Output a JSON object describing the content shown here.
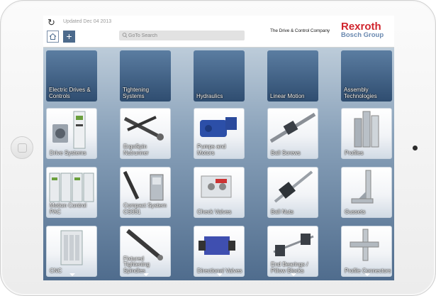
{
  "header": {
    "updated": "Updated Dec 04 2013",
    "search_placeholder": "GoTo Search",
    "tagline": "The Drive & Control Company",
    "brand_name": "Rexroth",
    "brand_sub": "Bosch Group",
    "add_label": "+"
  },
  "columns": [
    {
      "category": "Electric Drives & Controls",
      "products": [
        "Drive Systems",
        "Motion Control PAC",
        "CNC"
      ]
    },
    {
      "category": "Tightening Systems",
      "products": [
        "ErgoSpin Nutrunner",
        "Compact System CS351",
        "Fixtured Tightening Spindles"
      ]
    },
    {
      "category": "Hydraulics",
      "products": [
        "Pumps and Motors",
        "Check Valves",
        "Directional Valves"
      ]
    },
    {
      "category": "Linear Motion",
      "products": [
        "Ball Screws",
        "Ball Nuts",
        "End Bearings / Pillow Blocks"
      ]
    },
    {
      "category": "Assembly Technologies",
      "products": [
        "Profiles",
        "Gussets",
        "Profile Connectors"
      ]
    }
  ],
  "colors": {
    "brand_red": "#d0252d",
    "brand_blue": "#6a89b0",
    "accent": "#4c6a8c"
  },
  "icons": {
    "refresh": "refresh-icon",
    "home": "home-icon",
    "search": "search-icon",
    "more": "chevron-down-icon"
  }
}
